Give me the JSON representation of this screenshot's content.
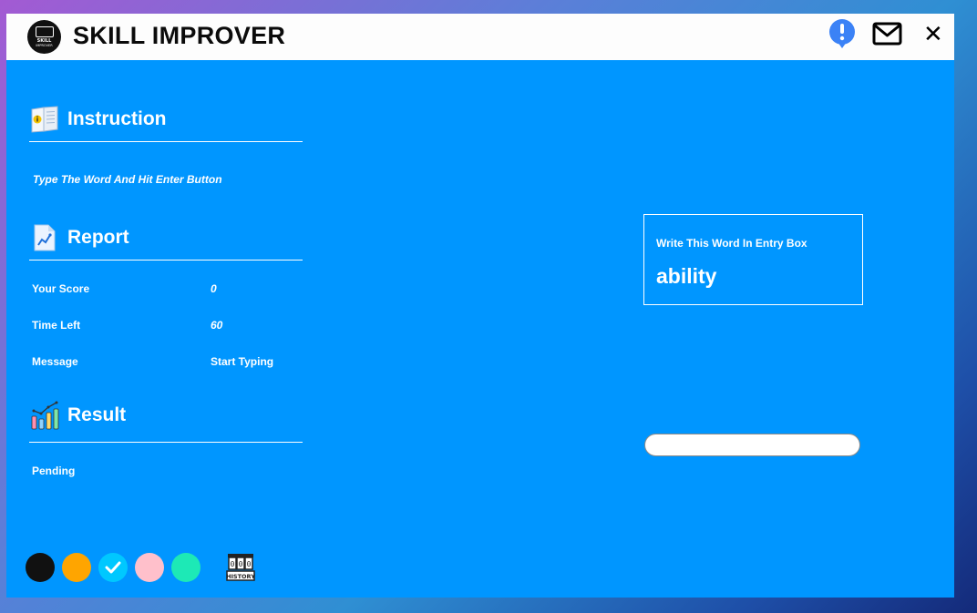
{
  "app": {
    "title": "SKILL IMPROVER",
    "logo_text_line1": "SKILL",
    "logo_text_line2": "IMPROVER"
  },
  "titlebar": {
    "alert_icon": "exclamation-bubble-icon",
    "mail_icon": "envelope-icon",
    "close_icon": "close-icon",
    "close_glyph": "✕"
  },
  "instruction": {
    "title": "Instruction",
    "icon": "instruction-book-icon",
    "text": "Type The Word And Hit Enter Button"
  },
  "report": {
    "title": "Report",
    "icon": "report-document-icon",
    "score_label": "Your Score",
    "score_value": "0",
    "time_label": "Time Left",
    "time_value": "60",
    "message_label": "Message",
    "message_value": "Start Typing"
  },
  "result": {
    "title": "Result",
    "icon": "result-bar-chart-icon",
    "status": "Pending"
  },
  "challenge": {
    "hint": "Write This Word In Entry Box",
    "word": "ability"
  },
  "entry": {
    "value": "",
    "placeholder": ""
  },
  "theme_swatches": [
    {
      "name": "black",
      "color": "#111111",
      "selected": false
    },
    {
      "name": "orange",
      "color": "#ffa500",
      "selected": false
    },
    {
      "name": "cyan",
      "color": "#00c8ff",
      "selected": true
    },
    {
      "name": "pink",
      "color": "#ffc0cb",
      "selected": false
    },
    {
      "name": "teal",
      "color": "#1de9b6",
      "selected": false
    }
  ],
  "history": {
    "label": "HISTORY",
    "icon": "history-counter-icon"
  },
  "colors": {
    "window_bg": "#0096ff",
    "titlebar_bg": "#fdfdfd",
    "alert_blue": "#3b82f6"
  }
}
